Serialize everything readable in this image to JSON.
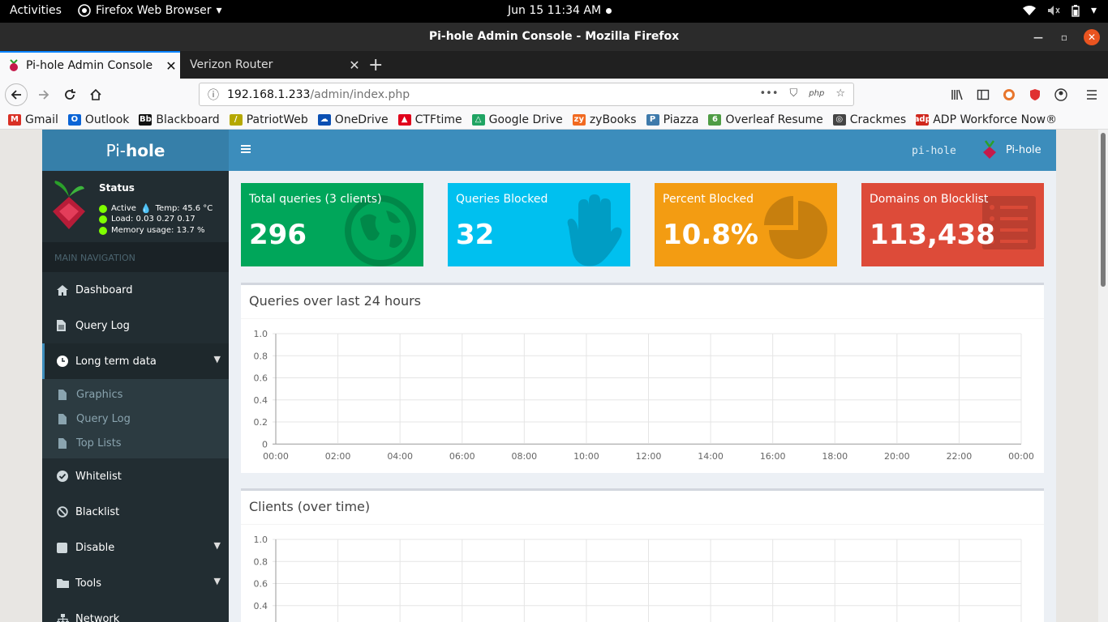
{
  "gnome": {
    "activities": "Activities",
    "app_menu": "Firefox Web Browser",
    "clock": "Jun 15  11:34 AM"
  },
  "window": {
    "title": "Pi-hole Admin Console - Mozilla Firefox"
  },
  "tabs": [
    {
      "label": "Pi-hole Admin Console",
      "active": true
    },
    {
      "label": "Verizon Router",
      "active": false
    }
  ],
  "url": {
    "host": "192.168.1.233",
    "path": "/admin/index.php"
  },
  "bookmarks": [
    {
      "label": "Gmail",
      "icon": "gmail-icon",
      "color": "#d93025",
      "glyph": "M"
    },
    {
      "label": "Outlook",
      "icon": "outlook-icon",
      "color": "#0a64d6",
      "glyph": "O"
    },
    {
      "label": "Blackboard",
      "icon": "blackboard-icon",
      "color": "#111111",
      "glyph": "Bb"
    },
    {
      "label": "PatriotWeb",
      "icon": "patriotweb-icon",
      "color": "#b5a800",
      "glyph": "/"
    },
    {
      "label": "OneDrive",
      "icon": "onedrive-icon",
      "color": "#0a4fb3",
      "glyph": "☁"
    },
    {
      "label": "CTFtime",
      "icon": "ctftime-icon",
      "color": "#e0001b",
      "glyph": "▲"
    },
    {
      "label": "Google Drive",
      "icon": "google-drive-icon",
      "color": "#1fa463",
      "glyph": "△"
    },
    {
      "label": "zyBooks",
      "icon": "zybooks-icon",
      "color": "#f16a21",
      "glyph": "zy"
    },
    {
      "label": "Piazza",
      "icon": "piazza-icon",
      "color": "#3e7aab",
      "glyph": "P"
    },
    {
      "label": "Overleaf Resume",
      "icon": "overleaf-icon",
      "color": "#4f9c45",
      "glyph": "6"
    },
    {
      "label": "Crackmes",
      "icon": "crackmes-icon",
      "color": "#444444",
      "glyph": "◎"
    },
    {
      "label": "ADP Workforce Now®",
      "icon": "adp-icon",
      "color": "#d0271d",
      "glyph": "adp"
    }
  ],
  "sidebar": {
    "logo_pre": "Pi-",
    "logo_bold": "hole",
    "status_title": "Status",
    "status_active": "Active",
    "status_temp": "Temp: 45.6 °C",
    "status_load": "Load:  0.03  0.27  0.17",
    "status_memory": "Memory usage:  13.7 %",
    "nav_header": "MAIN NAVIGATION",
    "items": {
      "dashboard": "Dashboard",
      "query_log": "Query Log",
      "long_term": "Long term data",
      "graphics": "Graphics",
      "lt_query_log": "Query Log",
      "top_lists": "Top Lists",
      "whitelist": "Whitelist",
      "blacklist": "Blacklist",
      "disable": "Disable",
      "tools": "Tools",
      "network": "Network"
    }
  },
  "header": {
    "hostname": "pi-hole",
    "user": "Pi-hole"
  },
  "stats": [
    {
      "title": "Total queries (3 clients)",
      "value": "296",
      "color": "#00a65a",
      "icon": "globe-icon"
    },
    {
      "title": "Queries Blocked",
      "value": "32",
      "color": "#00c0ef",
      "icon": "hand-icon"
    },
    {
      "title": "Percent Blocked",
      "value": "10.8%",
      "color": "#f39c12",
      "icon": "pie-chart-icon"
    },
    {
      "title": "Domains on Blocklist",
      "value": "113,438",
      "color": "#dd4b39",
      "icon": "list-icon"
    }
  ],
  "chart_data": [
    {
      "type": "line",
      "title": "Queries over last 24 hours",
      "categories": [
        "00:00",
        "02:00",
        "04:00",
        "06:00",
        "08:00",
        "10:00",
        "12:00",
        "14:00",
        "16:00",
        "18:00",
        "20:00",
        "22:00",
        "00:00"
      ],
      "yticks": [
        "1.0",
        "0.8",
        "0.6",
        "0.4",
        "0.2",
        "0"
      ],
      "ylim": [
        0,
        1
      ],
      "grid": true,
      "series": []
    },
    {
      "type": "line",
      "title": "Clients (over time)",
      "yticks": [
        "1.0",
        "0.8",
        "0.6",
        "0.4"
      ],
      "ylim": [
        0,
        1
      ],
      "grid": true,
      "series": []
    }
  ]
}
